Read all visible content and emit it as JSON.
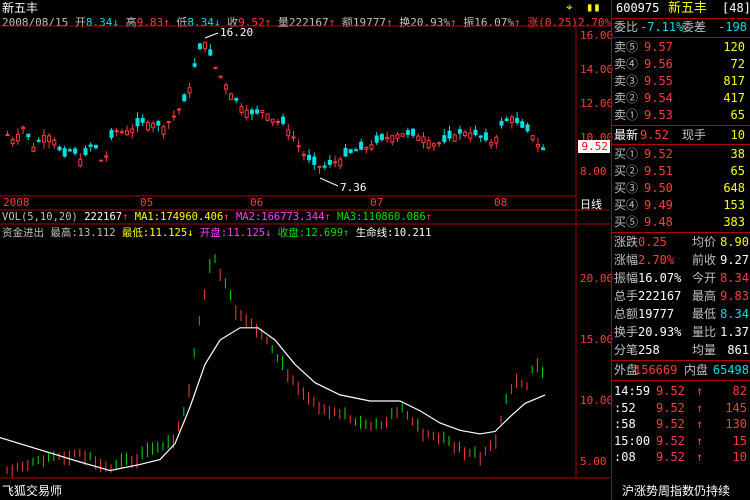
{
  "stock": {
    "name": "新五丰",
    "code": "600975",
    "code_suffix": "[48]"
  },
  "header": {
    "date": "2008/08/15",
    "open_label": "开",
    "open": "8.34",
    "high_label": "高",
    "high": "9.83",
    "low_label": "低",
    "low": "8.34",
    "close_label": "收",
    "close": "9.52",
    "volume_label": "量",
    "volume": "222167",
    "amount_label": "额",
    "amount": "19777",
    "turnover_label": "换",
    "turnover": "20.93%",
    "amplitude_label": "振",
    "amplitude": "16.07%",
    "change_label": "涨",
    "change": "(0.25)",
    "change_pct": "2.70%"
  },
  "price_chart": {
    "y_ticks": [
      "16.00",
      "14.00",
      "12.00",
      "10.00",
      "8.00"
    ],
    "x_ticks": [
      "2008",
      "05",
      "06",
      "07",
      "08"
    ],
    "x_mode": "日线",
    "high_marker": "16.20",
    "low_marker": "7.36",
    "current_price_tag": "9.52"
  },
  "vol_header": {
    "label": "VOL(5,10,20)",
    "vol": "222167",
    "ma1_label": "MA1:",
    "ma1": "174960.406",
    "ma2_label": "MA2:",
    "ma2": "166773.344",
    "ma3_label": "MA3:",
    "ma3": "110860.086"
  },
  "capital_header": {
    "title": "资金进出",
    "high_label": "最高:",
    "high": "13.112",
    "low_label": "最低:",
    "low": "11.125",
    "open_label": "开盘:",
    "open": "11.125",
    "close_label": "收盘:",
    "close": "12.699",
    "life_label": "生命线:",
    "life": "10.211"
  },
  "lower_chart": {
    "y_ticks": [
      "20.00",
      "15.00",
      "10.00",
      "5.00"
    ]
  },
  "footer": {
    "left_text": "飞狐交易师",
    "right_text": "沪涨势周指数仍持续"
  },
  "right_panel": {
    "ratio_label": "委比",
    "ratio": "-7.11%",
    "diff_label": "委差",
    "diff": "-198",
    "sells": [
      {
        "label": "卖⑤",
        "price": "9.57",
        "vol": "120"
      },
      {
        "label": "卖④",
        "price": "9.56",
        "vol": "72"
      },
      {
        "label": "卖③",
        "price": "9.55",
        "vol": "817"
      },
      {
        "label": "卖②",
        "price": "9.54",
        "vol": "417"
      },
      {
        "label": "卖①",
        "price": "9.53",
        "vol": "65"
      }
    ],
    "latest_label": "最新",
    "latest": "9.52",
    "current_hand_label": "现手",
    "current_hand": "10",
    "buys": [
      {
        "label": "买①",
        "price": "9.52",
        "vol": "38"
      },
      {
        "label": "买②",
        "price": "9.51",
        "vol": "65"
      },
      {
        "label": "买③",
        "price": "9.50",
        "vol": "648"
      },
      {
        "label": "买④",
        "price": "9.49",
        "vol": "153"
      },
      {
        "label": "买⑤",
        "price": "9.48",
        "vol": "383"
      }
    ],
    "stats": [
      {
        "l1": "涨跌",
        "v1": "0.25",
        "l2": "均价",
        "v2": "8.90"
      },
      {
        "l1": "涨幅",
        "v1": "2.70%",
        "l2": "前收",
        "v2": "9.27"
      },
      {
        "l1": "振幅",
        "v1": "16.07%",
        "l2": "今开",
        "v2": "8.34"
      },
      {
        "l1": "总手",
        "v1": "222167",
        "l2": "最高",
        "v2": "9.83"
      },
      {
        "l1": "总额",
        "v1": "19777",
        "l2": "最低",
        "v2": "8.34"
      },
      {
        "l1": "换手",
        "v1": "20.93%",
        "l2": "量比",
        "v2": "1.37"
      },
      {
        "l1": "分笔",
        "v1": "258",
        "l2": "均量",
        "v2": "861"
      }
    ],
    "outer_label": "外盘",
    "outer": "156669",
    "inner_label": "内盘",
    "inner": "65498",
    "ticks": [
      {
        "time": "14:59",
        "price": "9.52",
        "vol": "82"
      },
      {
        "time": ":52",
        "price": "9.52",
        "vol": "145"
      },
      {
        "time": ":58",
        "price": "9.52",
        "vol": "130"
      },
      {
        "time": "15:00",
        "price": "9.52",
        "vol": "15"
      },
      {
        "time": ":08",
        "price": "9.52",
        "vol": "10"
      }
    ]
  },
  "colors": {
    "up": "#ff3b3b",
    "down": "#00e0e0",
    "frame": "#b00000",
    "ma_line": "#ffffff"
  }
}
